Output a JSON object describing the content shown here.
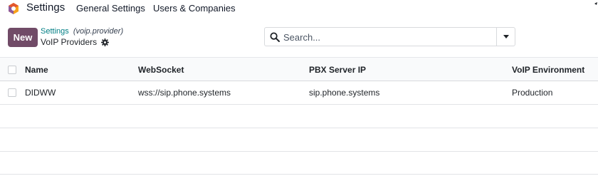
{
  "navbar": {
    "app_name": "Settings",
    "menu": [
      {
        "label": "General Settings"
      },
      {
        "label": "Users & Companies"
      }
    ]
  },
  "control_panel": {
    "new_label": "New",
    "breadcrumb": {
      "link": "Settings",
      "model": "(voip.provider)"
    },
    "title": "VoIP Providers",
    "search": {
      "placeholder": "Search..."
    }
  },
  "table": {
    "columns": [
      "Name",
      "WebSocket",
      "PBX Server IP",
      "VoIP Environment"
    ],
    "rows": [
      {
        "name": "DIDWW",
        "websocket": "wss://sip.phone.systems",
        "pbx": "sip.phone.systems",
        "environment": "Production"
      }
    ]
  },
  "colors": {
    "primary": "#714b67",
    "link": "#017e84",
    "logo_orange": "#f7a21b",
    "logo_red": "#e4572e",
    "logo_purple": "#8e5a9c"
  },
  "icons": [
    "odoo-logo-icon",
    "gear-icon",
    "search-icon",
    "caret-down-icon"
  ]
}
